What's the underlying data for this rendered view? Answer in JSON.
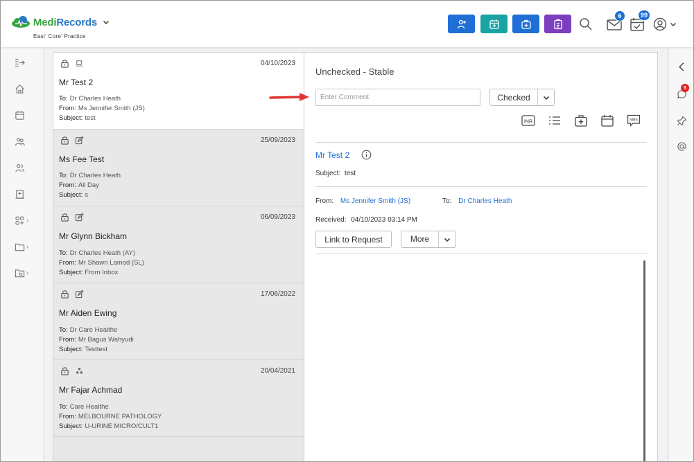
{
  "app": {
    "name_part1": "Medi",
    "name_part2": "Records",
    "practice": "East' Core' Practice"
  },
  "header": {
    "quick_buttons": [
      {
        "name": "add-patient",
        "color": "#1f6fd6"
      },
      {
        "name": "appointment",
        "color": "#1aa3a3"
      },
      {
        "name": "medical-kit",
        "color": "#1f6fd6"
      },
      {
        "name": "clipboard",
        "color": "#7b3fbf"
      }
    ],
    "mail_badge": "6",
    "tasks_badge": "99"
  },
  "messages": [
    {
      "date": "04/10/2023",
      "name": "Mr Test 2",
      "to": "Dr Charles Heath",
      "from": "Ms Jennifer Smith (JS)",
      "subject": "test",
      "second_icon": "device-icon",
      "selected": true
    },
    {
      "date": "25/09/2023",
      "name": "Ms Fee Test",
      "to": "Dr Charles Heath",
      "from": "All Day",
      "subject": "s",
      "second_icon": "edit-icon",
      "selected": false
    },
    {
      "date": "06/09/2023",
      "name": "Mr Glynn Bickham",
      "to": "Dr Charles Heath (AY)",
      "from": "Mr Shawn Lamod (SL)",
      "subject": "From Inbox",
      "second_icon": "edit-icon",
      "selected": false
    },
    {
      "date": "17/06/2022",
      "name": "Mr Aiden Ewing",
      "to": "Dr Care Healthe",
      "from": "Mr Bagus Wahyudi",
      "subject": "Testtest",
      "second_icon": "edit-icon",
      "selected": false
    },
    {
      "date": "20/04/2021",
      "name": "Mr Fajar Achmad",
      "to": "Care Healthe",
      "from": "MELBOURNE PATHOLOGY",
      "subject": "U-URINE MICRO/CULT1",
      "second_icon": "network-icon",
      "selected": false
    }
  ],
  "labels": {
    "to": "To:",
    "from": "From:",
    "subject": "Subject:",
    "received": "Received:"
  },
  "detail": {
    "status": "Unchecked - Stable",
    "comment_placeholder": "Enter Comment",
    "checked_label": "Checked",
    "patient": "Mr Test 2",
    "subject": "test",
    "from": "Ms Jennifer Smith (JS)",
    "to": "Dr Charles Heath",
    "received": "04/10/2023 03:14 PM",
    "link_to_request": "Link to Request",
    "more": "More",
    "tool_icons": [
      "inr-icon",
      "list-icon",
      "medical-kit-icon",
      "calendar-icon",
      "sms-icon"
    ],
    "inr_text": "INR",
    "sms_text": "SMS"
  },
  "right_rail": {
    "notification_badge": "5"
  }
}
